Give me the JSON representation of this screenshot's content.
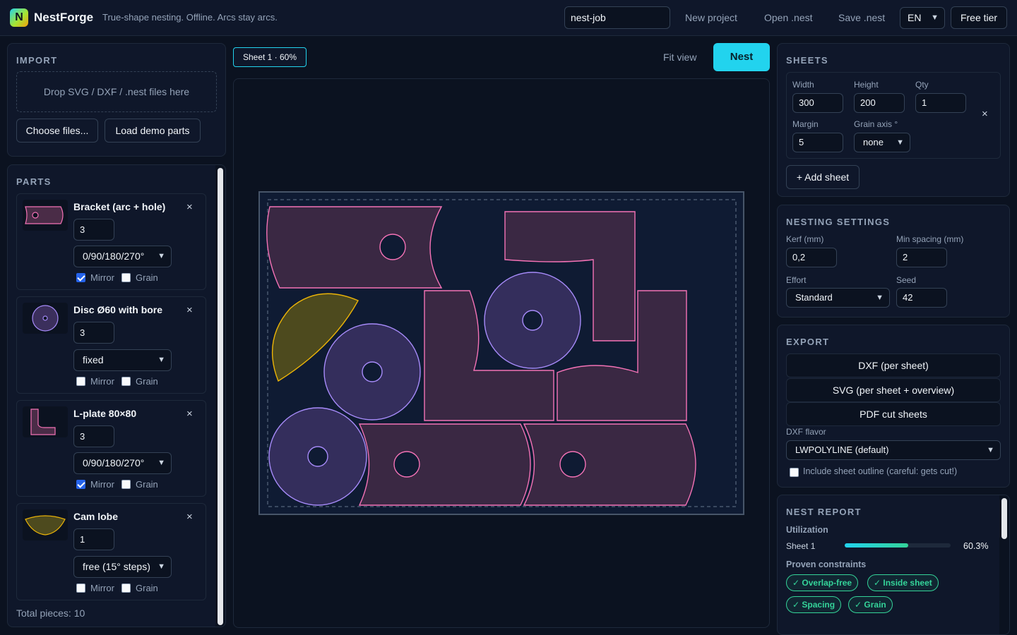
{
  "header": {
    "logo_letter": "N",
    "app_name": "NestForge",
    "tagline": "True-shape nesting. Offline. Arcs stay arcs.",
    "job_name": "nest-job",
    "new_project": "New project",
    "open_nest": "Open .nest",
    "save_nest": "Save .nest",
    "language": "EN",
    "tier": "Free tier"
  },
  "import": {
    "title": "IMPORT",
    "dropzone": "Drop SVG / DXF / .nest files here",
    "choose_files": "Choose files...",
    "load_demo": "Load demo parts"
  },
  "parts": {
    "title": "PARTS",
    "mirror_label": "Mirror",
    "grain_label": "Grain",
    "items": [
      {
        "name": "Bracket (arc + hole)",
        "qty": "3",
        "rotation": "0/90/180/270°",
        "mirror": true,
        "grain": false
      },
      {
        "name": "Disc Ø60 with bore",
        "qty": "3",
        "rotation": "fixed",
        "mirror": false,
        "grain": false
      },
      {
        "name": "L-plate 80×80",
        "qty": "3",
        "rotation": "0/90/180/270°",
        "mirror": true,
        "grain": false
      },
      {
        "name": "Cam lobe",
        "qty": "1",
        "rotation": "free (15° steps)",
        "mirror": false,
        "grain": false
      }
    ],
    "total": "Total pieces: 10"
  },
  "toolbar": {
    "sheet_tab": "Sheet 1 · 60%",
    "fit_view": "Fit view",
    "nest": "Nest"
  },
  "sheets": {
    "title": "SHEETS",
    "width_label": "Width",
    "height_label": "Height",
    "qty_label": "Qty",
    "margin_label": "Margin",
    "grain_axis_label": "Grain axis °",
    "width": "300",
    "height": "200",
    "qty": "1",
    "margin": "5",
    "grain_axis": "none",
    "add_sheet": "+ Add sheet"
  },
  "nesting": {
    "title": "NESTING SETTINGS",
    "kerf_label": "Kerf (mm)",
    "spacing_label": "Min spacing (mm)",
    "effort_label": "Effort",
    "seed_label": "Seed",
    "kerf": "0,2",
    "spacing": "2",
    "effort": "Standard",
    "seed": "42"
  },
  "export": {
    "title": "EXPORT",
    "dxf": "DXF (per sheet)",
    "svg": "SVG (per sheet + overview)",
    "pdf": "PDF cut sheets",
    "flavor_label": "DXF flavor",
    "flavor": "LWPOLYLINE (default)",
    "include_outline": "Include sheet outline (careful: gets cut!)"
  },
  "report": {
    "title": "NEST REPORT",
    "utilization_label": "Utilization",
    "sheet_name": "Sheet 1",
    "utilization_value": "60.3%",
    "utilization_fraction": 0.603,
    "constraints_label": "Proven constraints",
    "chips": [
      "✓ Overlap-free",
      "✓ Inside sheet",
      "✓ Spacing",
      "✓ Grain"
    ]
  },
  "colors": {
    "accent": "#22d3ee",
    "pink_outline": "#f472b6",
    "violet_outline": "#a78bfa",
    "yellow_outline": "#eab308",
    "ok_green": "#34d399"
  }
}
